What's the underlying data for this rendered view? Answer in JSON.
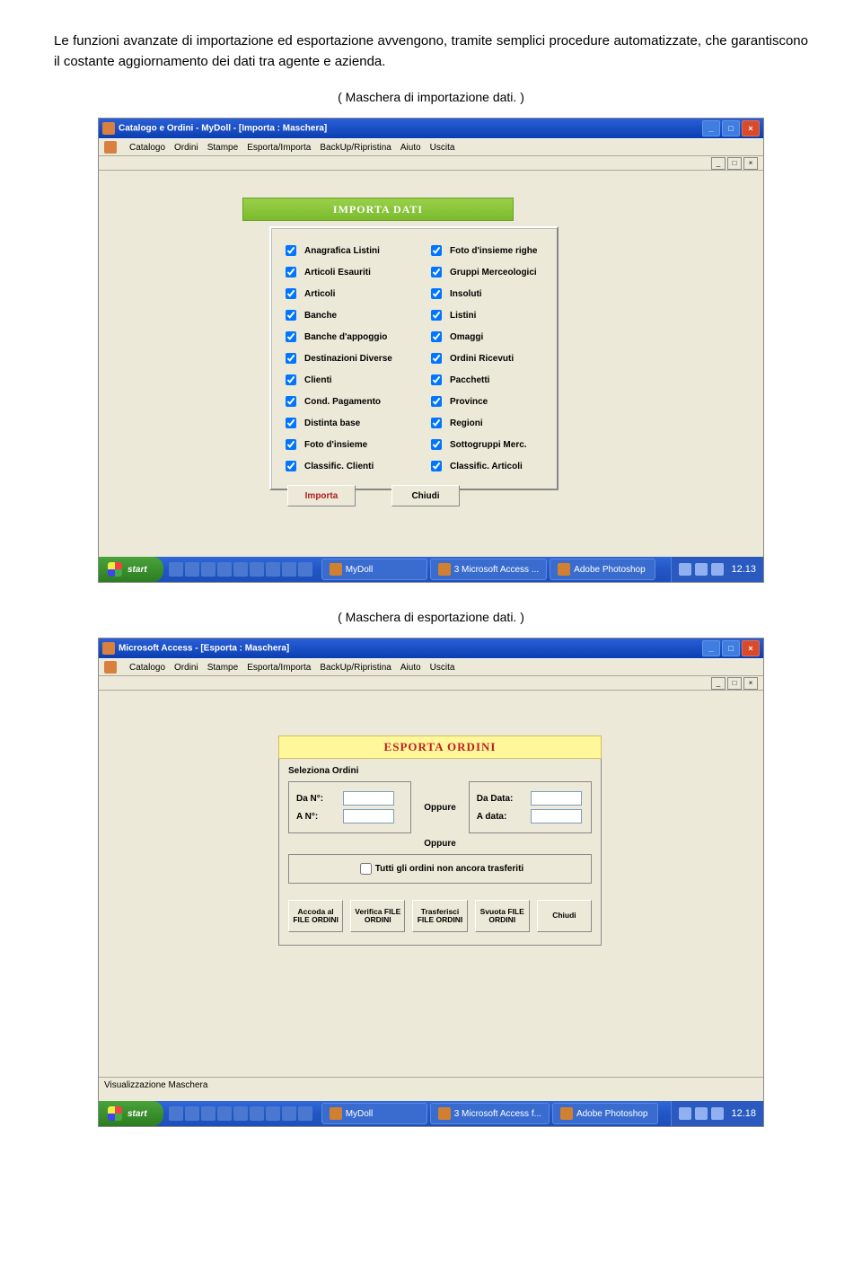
{
  "intro": "Le funzioni avanzate di importazione ed esportazione avvengono, tramite semplici procedure automatizzate, che garantiscono il costante aggiornamento dei dati tra agente e azienda.",
  "caption1": "( Maschera di importazione dati. )",
  "caption2": "( Maschera di esportazione dati. )",
  "scr1": {
    "title": "Catalogo e Ordini - MyDoll - [Importa : Maschera]",
    "menus": [
      "Catalogo",
      "Ordini",
      "Stampe",
      "Esporta/Importa",
      "BackUp/Ripristina",
      "Aiuto",
      "Uscita"
    ],
    "panel_title": "IMPORTA DATI",
    "left": [
      "Anagrafica Listini",
      "Articoli Esauriti",
      "Articoli",
      "Banche",
      "Banche d'appoggio",
      "Destinazioni Diverse",
      "Clienti",
      "Cond. Pagamento",
      "Distinta base",
      "Foto d'insieme",
      "Classific. Clienti"
    ],
    "right": [
      "Foto d'insieme righe",
      "Gruppi Merceologici",
      "Insoluti",
      "Listini",
      "Omaggi",
      "Ordini Ricevuti",
      "Pacchetti",
      "Province",
      "Regioni",
      "Sottogruppi Merc.",
      "Classific. Articoli"
    ],
    "btn_import": "Importa",
    "btn_close": "Chiudi",
    "task_mydoll": "MyDoll",
    "task_access": "3 Microsoft Access ...",
    "task_ps": "Adobe Photoshop",
    "clock": "12.13"
  },
  "scr2": {
    "title": "Microsoft Access - [Esporta : Maschera]",
    "menus": [
      "Catalogo",
      "Ordini",
      "Stampe",
      "Esporta/Importa",
      "BackUp/Ripristina",
      "Aiuto",
      "Uscita"
    ],
    "panel_title": "ESPORTA ORDINI",
    "seleziona": "Seleziona Ordini",
    "da_n": "Da N°:",
    "a_n": "A N°:",
    "oppure": "Oppure",
    "da_data": "Da Data:",
    "a_data": "A data:",
    "tutti": "Tutti gli ordini non ancora trasferiti",
    "btns": [
      "Accoda al FILE ORDINI",
      "Verifica FILE ORDINI",
      "Trasferisci FILE ORDINI",
      "Svuota FILE ORDINI",
      "Chiudi"
    ],
    "status": "Visualizzazione Maschera",
    "task_mydoll": "MyDoll",
    "task_access": "3 Microsoft Access f...",
    "task_ps": "Adobe Photoshop",
    "clock": "12.18"
  },
  "start_label": "start"
}
